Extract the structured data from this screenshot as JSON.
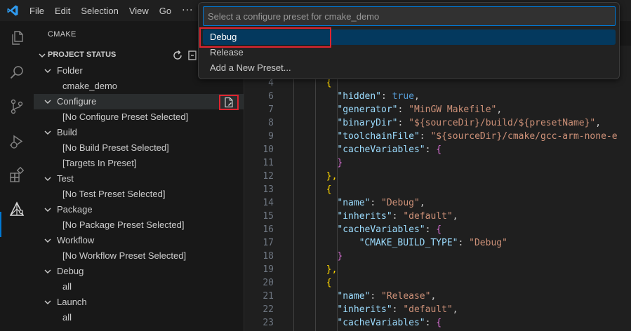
{
  "titlebar": {
    "menu": [
      "File",
      "Edit",
      "Selection",
      "View",
      "Go"
    ],
    "more": "···"
  },
  "activity_bar": {
    "icons": [
      "explorer-icon",
      "search-icon",
      "source-control-icon",
      "run-debug-icon",
      "extensions-icon",
      "cmake-icon"
    ],
    "active": "cmake-icon"
  },
  "sidebar": {
    "title": "CMAKE",
    "section": {
      "title": "PROJECT STATUS",
      "actions": [
        "refresh-icon",
        "collapse-icon"
      ]
    },
    "tree": [
      {
        "label": "Folder",
        "type": "group"
      },
      {
        "label": "cmake_demo",
        "type": "child"
      },
      {
        "label": "Configure",
        "type": "group",
        "selected": true
      },
      {
        "label": "[No Configure Preset Selected]",
        "type": "child"
      },
      {
        "label": "Build",
        "type": "group"
      },
      {
        "label": "[No Build Preset Selected]",
        "type": "child"
      },
      {
        "label": "[Targets In Preset]",
        "type": "child"
      },
      {
        "label": "Test",
        "type": "group"
      },
      {
        "label": "[No Test Preset Selected]",
        "type": "child"
      },
      {
        "label": "Package",
        "type": "group"
      },
      {
        "label": "[No Package Preset Selected]",
        "type": "child"
      },
      {
        "label": "Workflow",
        "type": "group"
      },
      {
        "label": "[No Workflow Preset Selected]",
        "type": "child"
      },
      {
        "label": "Debug",
        "type": "group"
      },
      {
        "label": "all",
        "type": "child"
      },
      {
        "label": "Launch",
        "type": "group"
      },
      {
        "label": "all",
        "type": "child"
      }
    ]
  },
  "editor": {
    "lines": [
      {
        "n": "4",
        "ind": 6,
        "t": [
          [
            "{",
            "b2"
          ]
        ]
      },
      {
        "n": "6",
        "ind": 8,
        "t": [
          [
            "\"hidden\"",
            "k"
          ],
          [
            ": ",
            "p"
          ],
          [
            "true",
            "kw"
          ],
          [
            ",",
            "p"
          ]
        ]
      },
      {
        "n": "7",
        "ind": 8,
        "t": [
          [
            "\"generator\"",
            "k"
          ],
          [
            ": ",
            "p"
          ],
          [
            "\"MinGW Makefile\"",
            "s"
          ],
          [
            ",",
            "p"
          ]
        ]
      },
      {
        "n": "8",
        "ind": 8,
        "t": [
          [
            "\"binaryDir\"",
            "k"
          ],
          [
            ": ",
            "p"
          ],
          [
            "\"${sourceDir}/build/${presetName}\"",
            "s"
          ],
          [
            ",",
            "p"
          ]
        ]
      },
      {
        "n": "9",
        "ind": 8,
        "t": [
          [
            "\"toolchainFile\"",
            "k"
          ],
          [
            ": ",
            "p"
          ],
          [
            "\"${sourceDir}/cmake/gcc-arm-none-e",
            "s"
          ]
        ]
      },
      {
        "n": "10",
        "ind": 8,
        "t": [
          [
            "\"cacheVariables\"",
            "k"
          ],
          [
            ": ",
            "p"
          ],
          [
            "{",
            "b3"
          ]
        ]
      },
      {
        "n": "11",
        "ind": 8,
        "t": [
          [
            "}",
            "b3"
          ]
        ]
      },
      {
        "n": "12",
        "ind": 6,
        "t": [
          [
            "},",
            "b2"
          ]
        ]
      },
      {
        "n": "13",
        "ind": 6,
        "t": [
          [
            "{",
            "b2"
          ]
        ]
      },
      {
        "n": "14",
        "ind": 8,
        "t": [
          [
            "\"name\"",
            "k"
          ],
          [
            ": ",
            "p"
          ],
          [
            "\"Debug\"",
            "s"
          ],
          [
            ",",
            "p"
          ]
        ]
      },
      {
        "n": "15",
        "ind": 8,
        "t": [
          [
            "\"inherits\"",
            "k"
          ],
          [
            ": ",
            "p"
          ],
          [
            "\"default\"",
            "s"
          ],
          [
            ",",
            "p"
          ]
        ]
      },
      {
        "n": "16",
        "ind": 8,
        "t": [
          [
            "\"cacheVariables\"",
            "k"
          ],
          [
            ": ",
            "p"
          ],
          [
            "{",
            "b3"
          ]
        ]
      },
      {
        "n": "17",
        "ind": 12,
        "t": [
          [
            "\"CMAKE_BUILD_TYPE\"",
            "k"
          ],
          [
            ": ",
            "p"
          ],
          [
            "\"Debug\"",
            "s"
          ]
        ]
      },
      {
        "n": "18",
        "ind": 8,
        "t": [
          [
            "}",
            "b3"
          ]
        ]
      },
      {
        "n": "19",
        "ind": 6,
        "t": [
          [
            "},",
            "b2"
          ]
        ]
      },
      {
        "n": "20",
        "ind": 6,
        "t": [
          [
            "{",
            "b2"
          ]
        ]
      },
      {
        "n": "21",
        "ind": 8,
        "t": [
          [
            "\"name\"",
            "k"
          ],
          [
            ": ",
            "p"
          ],
          [
            "\"Release\"",
            "s"
          ],
          [
            ",",
            "p"
          ]
        ]
      },
      {
        "n": "22",
        "ind": 8,
        "t": [
          [
            "\"inherits\"",
            "k"
          ],
          [
            ": ",
            "p"
          ],
          [
            "\"default\"",
            "s"
          ],
          [
            ",",
            "p"
          ]
        ]
      },
      {
        "n": "23",
        "ind": 8,
        "t": [
          [
            "\"cacheVariables\"",
            "k"
          ],
          [
            ": ",
            "p"
          ],
          [
            "{",
            "b3"
          ]
        ]
      }
    ]
  },
  "quickpick": {
    "placeholder": "Select a configure preset for cmake_demo",
    "items": [
      "Debug",
      "Release",
      "Add a New Preset..."
    ],
    "active_index": 0
  }
}
